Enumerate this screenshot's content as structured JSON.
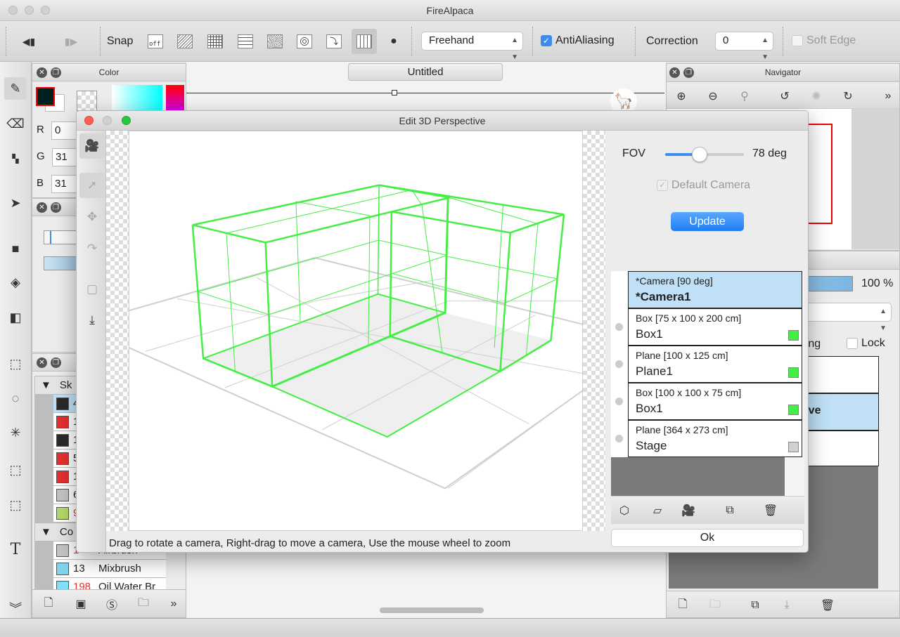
{
  "app": {
    "title": "FireAlpaca"
  },
  "toolbar": {
    "snap_label": "Snap",
    "snap_off_label": "off",
    "snap_modes": [
      "snap-off",
      "parallel",
      "grid",
      "crisscross",
      "radial",
      "circle",
      "curve",
      "3d-perspective",
      "dot"
    ],
    "brush_mode": "Freehand",
    "antialiasing_label": "AntiAliasing",
    "antialiasing_checked": true,
    "correction_label": "Correction",
    "correction_value": "0",
    "soft_edge_label": "Soft Edge",
    "soft_edge_checked": false
  },
  "color_panel": {
    "title": "Color",
    "r_label": "R",
    "r": "0",
    "g_label": "G",
    "g": "31",
    "b_label": "B",
    "b": "31",
    "fg_color": "#001f1f"
  },
  "brush_panel": {
    "groups": [
      {
        "label": "Sk"
      },
      {
        "label": "Co"
      }
    ],
    "rows": [
      {
        "num": "4",
        "color": "#2a2a2a",
        "num_color": "#222"
      },
      {
        "num": "1",
        "color": "#e53030",
        "num_color": "#222"
      },
      {
        "num": "1",
        "color": "#2a2a2a",
        "num_color": "#222"
      },
      {
        "num": "5",
        "color": "#e53030",
        "num_color": "#222"
      },
      {
        "num": "1",
        "color": "#e53030",
        "num_color": "#222"
      },
      {
        "num": "6",
        "color": "#c4c4c4",
        "num_color": "#222"
      },
      {
        "num": "9",
        "color": "#b5d86a",
        "num_color": "#e53030"
      }
    ],
    "rows2": [
      {
        "num": "1",
        "name": "Airbrush",
        "color": "#c4c4c4",
        "num_color": "#e53030"
      },
      {
        "num": "13",
        "name": "Mixbrush",
        "color": "#7fd4f0",
        "num_color": "#222"
      },
      {
        "num": "198",
        "name": "Oil Water Br",
        "color": "#7fe0f8",
        "num_color": "#e53030"
      }
    ]
  },
  "canvas": {
    "tab": "Untitled"
  },
  "navigator": {
    "title": "Navigator"
  },
  "layer_panel": {
    "opacity": "100 %",
    "opacity_value": 100,
    "clipping_fragment": "pping",
    "lock_label": "Lock",
    "active_fragment": "ctive"
  },
  "dialog": {
    "title": "Edit 3D Perspective",
    "fov_label": "FOV",
    "fov_value": 78,
    "fov_text": "78 deg",
    "fov_max": 180,
    "default_camera_label": "Default Camera",
    "default_camera_checked": true,
    "update_label": "Update",
    "objects": [
      {
        "type": "*Camera [90 deg]",
        "name": "*Camera1",
        "selected": true,
        "color": null
      },
      {
        "type": "Box [75 x 100 x 200 cm]",
        "name": "Box1",
        "selected": false,
        "color": "#44ee44"
      },
      {
        "type": "Plane [100 x 125 cm]",
        "name": "Plane1",
        "selected": false,
        "color": "#44ee44"
      },
      {
        "type": "Box [100 x 100 x 75 cm]",
        "name": "Box1",
        "selected": false,
        "color": "#44ee44"
      },
      {
        "type": "Plane [364 x 273 cm]",
        "name": "Stage",
        "selected": false,
        "color": "#d0d0d0"
      }
    ],
    "status": "Drag to rotate a camera, Right-drag to move a camera, Use the mouse wheel to zoom",
    "ok_label": "Ok",
    "wire_color": "#44ee44"
  }
}
